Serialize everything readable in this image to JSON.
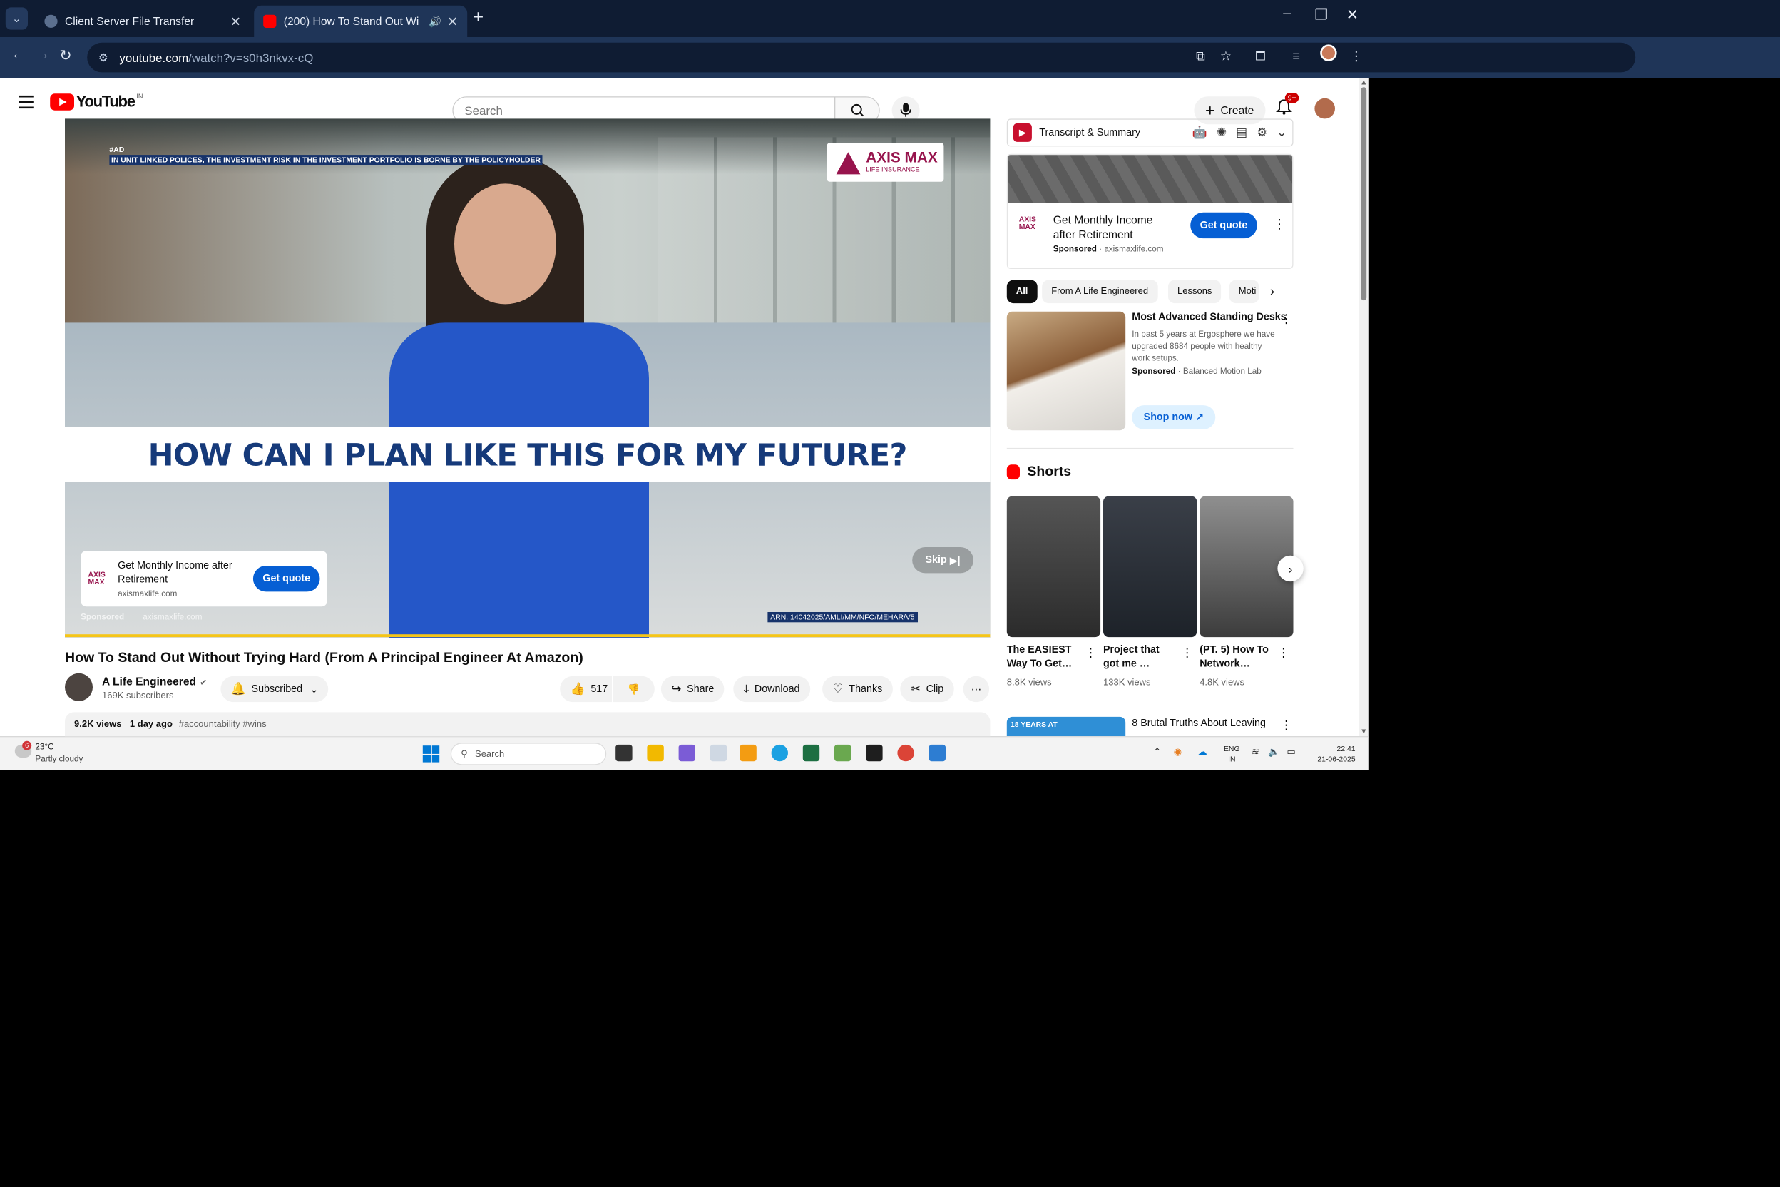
{
  "browser": {
    "tabs": [
      {
        "label": "Client Server File Transfer",
        "active": false
      },
      {
        "label": "(200) How To Stand Out Wi",
        "active": true
      }
    ],
    "url_host": "youtube.com",
    "url_path": "/watch?v=s0h3nkvx-cQ"
  },
  "youtube": {
    "logo_text": "YouTube",
    "country_code": "IN",
    "search_placeholder": "Search",
    "create_label": "Create",
    "notification_count": "9+"
  },
  "video": {
    "ad_tag": "#AD",
    "ad_disclaimer": "IN UNIT LINKED POLICES, THE INVESTMENT RISK IN THE INVESTMENT PORTFOLIO IS BORNE BY THE POLICYHOLDER",
    "brand_name": "AXIS MAX",
    "brand_sub": "LIFE INSURANCE",
    "headline": "HOW CAN I PLAN LIKE THIS FOR MY FUTURE?",
    "ad_card_title": "Get Monthly Income after Retirement",
    "ad_card_domain": "axismaxlife.com",
    "ad_card_cta": "Get quote",
    "sponsored_label": "Sponsored",
    "sponsored_domain": "axismaxlife.com",
    "skip_label": "Skip",
    "arn": "ARN: 14042025/AMLI/MM/NFO/MEHAR/V5",
    "title": "How To Stand Out Without Trying Hard (From A Principal Engineer At Amazon)",
    "channel_name": "A Life Engineered",
    "subscribers": "169K subscribers",
    "subscribed_label": "Subscribed",
    "likes": "517",
    "share_label": "Share",
    "download_label": "Download",
    "thanks_label": "Thanks",
    "clip_label": "Clip",
    "views": "9.2K views",
    "age": "1 day ago",
    "tags": "#accountability #wins"
  },
  "sidebar": {
    "extension_title": "Transcript & Summary",
    "ad": {
      "logo": "AXIS MAX",
      "title": "Get Monthly Income after Retirement",
      "sponsored": "Sponsored",
      "domain": "axismaxlife.com",
      "cta": "Get quote"
    },
    "chips": [
      "All",
      "From A Life Engineered",
      "Lessons",
      "Moti"
    ],
    "desk_ad": {
      "title": "Most Advanced Standing Desks",
      "desc": "In past 5 years at Ergosphere we have upgraded 8684 people with healthy work setups.",
      "sponsored": "Sponsored",
      "advertiser": "Balanced Motion Lab",
      "cta": "Shop now"
    },
    "shorts_heading": "Shorts",
    "shorts": [
      {
        "title": "The EASIEST Way To Get…",
        "views": "8.8K views"
      },
      {
        "title": "Project that got me …",
        "views": "133K views"
      },
      {
        "title": "(PT. 5) How To Network…",
        "views": "4.8K views"
      }
    ],
    "next_video": {
      "thumb_text": "18 YEARS AT",
      "title": "8 Brutal Truths About Leaving"
    }
  },
  "taskbar": {
    "weather_temp": "23°C",
    "weather_desc": "Partly cloudy",
    "weather_badge": "6",
    "search_placeholder": "Search",
    "lang_1": "ENG",
    "lang_2": "IN",
    "time": "22:41",
    "date": "21-06-2025"
  },
  "colors": {
    "browser_frame": "#0f1c33",
    "browser_toolbar": "#1f3558",
    "youtube_red": "#ff0000",
    "cta_blue": "#065fd4",
    "axis_maroon": "#97144d",
    "headline_navy": "#163a7a"
  }
}
